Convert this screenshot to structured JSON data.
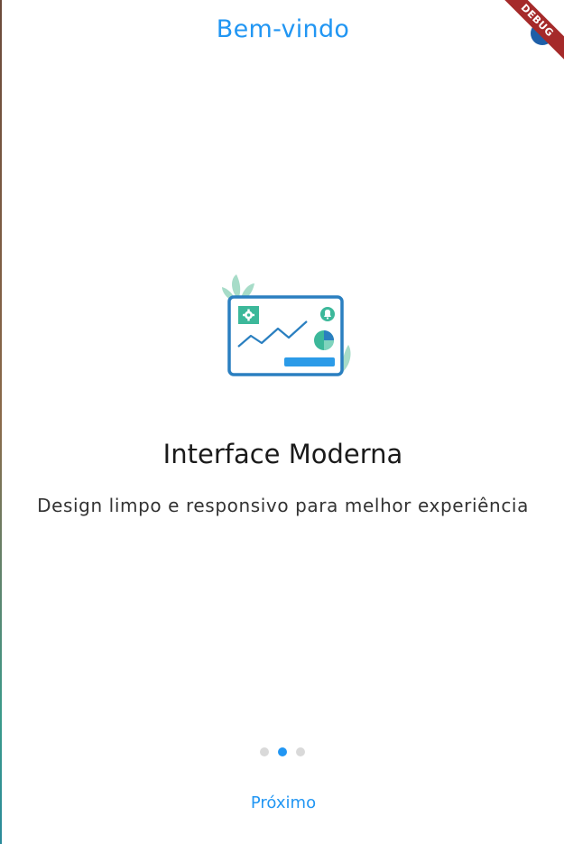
{
  "header": {
    "title": "Bem-vindo"
  },
  "debug_banner": {
    "label": "DEBUG"
  },
  "slide": {
    "illustration": "dashboard-illustration",
    "title": "Interface Moderna",
    "description": "Design limpo e responsivo para melhor experiência"
  },
  "pagination": {
    "total": 3,
    "active_index": 1
  },
  "footer": {
    "next_label": "Próximo"
  },
  "colors": {
    "accent": "#2196f3",
    "illustration_stroke": "#2a7fc0",
    "illustration_green": "#3cb89a",
    "debug_ribbon": "#a52a2a"
  }
}
